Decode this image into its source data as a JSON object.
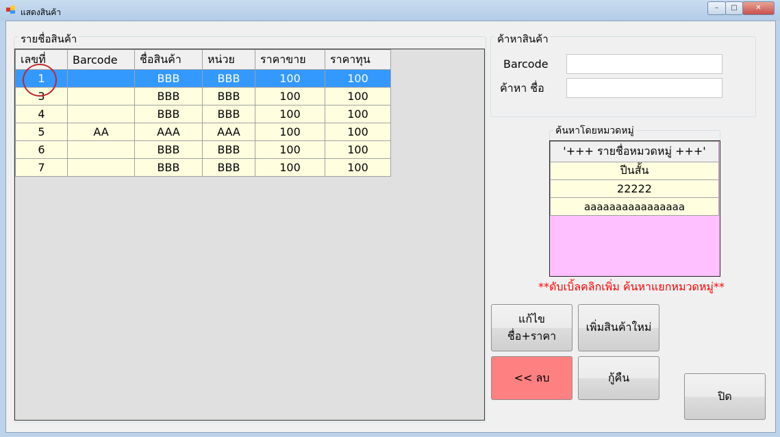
{
  "window": {
    "title": "แสดงสินค้า",
    "min": "–",
    "max": "□",
    "close": "✕"
  },
  "products": {
    "group_label": "รายชื่อสินค้า",
    "columns": [
      "เลขที่",
      "Barcode",
      "ชื่อสินค้า",
      "หน่วย",
      "ราคาขาย",
      "ราคาทุน"
    ],
    "rows": [
      [
        "1",
        "",
        "BBB",
        "BBB",
        "100",
        "100"
      ],
      [
        "3",
        "",
        "BBB",
        "BBB",
        "100",
        "100"
      ],
      [
        "4",
        "",
        "BBB",
        "BBB",
        "100",
        "100"
      ],
      [
        "5",
        "AA",
        "AAA",
        "AAA",
        "100",
        "100"
      ],
      [
        "6",
        "",
        "BBB",
        "BBB",
        "100",
        "100"
      ],
      [
        "7",
        "",
        "BBB",
        "BBB",
        "100",
        "100"
      ]
    ]
  },
  "search": {
    "group_label": "ค้าหาสินค้า",
    "barcode_label": "Barcode",
    "name_label": "ค้าหา ชื่อ",
    "barcode_value": "",
    "name_value": ""
  },
  "category": {
    "group_label": "ค้นหาโดยหมวดหมู่",
    "header": "'+++ รายชื่อหมวดหมู่ +++'",
    "items": [
      "ปีนสั้น",
      "22222",
      "aaaaaaaaaaaaaaaa"
    ],
    "hint": "**ดับเบิ้ลคลิกเพิ่ม ค้นหาแยกหมวดหมู่**"
  },
  "buttons": {
    "edit_line1": "แก้ไข",
    "edit_line2": "ชื่อ+ราคา",
    "add": "เพิ่มสินค้าใหม่",
    "delete": "<< ลบ",
    "restore": "กู้คืน",
    "close": "ปิด"
  },
  "colors": {
    "selected": "#3399ff",
    "row": "#ffffe0",
    "category_bg": "#ffc0ff",
    "delete_button": "#ff8080",
    "hint": "#ff0000"
  }
}
